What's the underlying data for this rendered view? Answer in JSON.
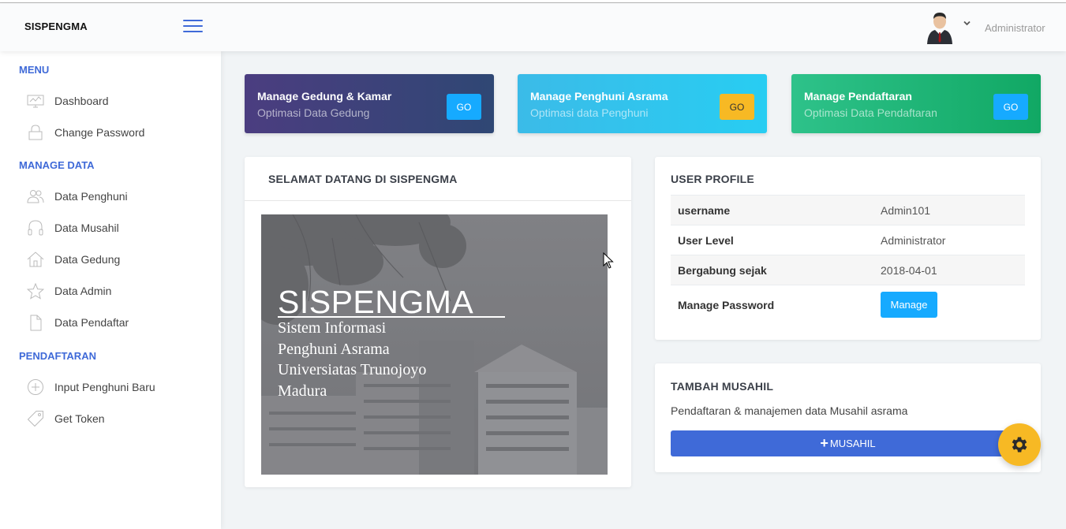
{
  "header": {
    "brand": "SISPENGMA",
    "user_name": "Administrator"
  },
  "sidebar": {
    "sections": [
      {
        "title": "MENU",
        "items": [
          {
            "label": "Dashboard",
            "icon": "monitor-icon"
          },
          {
            "label": "Change Password",
            "icon": "lock-icon"
          }
        ]
      },
      {
        "title": "MANAGE DATA",
        "items": [
          {
            "label": "Data Penghuni",
            "icon": "users-icon"
          },
          {
            "label": "Data Musahil",
            "icon": "headphones-icon"
          },
          {
            "label": "Data Gedung",
            "icon": "home-icon"
          },
          {
            "label": "Data Admin",
            "icon": "star-icon"
          },
          {
            "label": "Data Pendaftar",
            "icon": "file-icon"
          }
        ]
      },
      {
        "title": "PENDAFTARAN",
        "items": [
          {
            "label": "Input Penghuni Baru",
            "icon": "plus-circle-icon"
          },
          {
            "label": "Get Token",
            "icon": "tag-icon"
          }
        ]
      }
    ]
  },
  "tiles": [
    {
      "title": "Manage Gedung & Kamar",
      "subtitle": "Optimasi Data Gedung",
      "button": "GO",
      "button_color": "#16aaff"
    },
    {
      "title": "Manage Penghuni Asrama",
      "subtitle": "Optimasi data Penghuni",
      "button": "GO",
      "button_color": "#f7b924"
    },
    {
      "title": "Manage Pendaftaran",
      "subtitle": "Optimasi Data Pendaftaran",
      "button": "GO",
      "button_color": "#16aaff"
    }
  ],
  "welcome": {
    "title": "SELAMAT DATANG DI SISPENGMA",
    "hero_title": "SISPENGMA",
    "hero_lines": [
      "Sistem Informasi",
      "Penghuni Asrama",
      "Universiatas Trunojoyo",
      "Madura"
    ]
  },
  "profile": {
    "title": "USER PROFILE",
    "rows": [
      {
        "key": "username",
        "value": "Admin101"
      },
      {
        "key": "User Level",
        "value": "Administrator"
      },
      {
        "key": "Bergabung sejak",
        "value": "2018-04-01"
      }
    ],
    "password_label": "Manage Password",
    "manage_button": "Manage"
  },
  "musahil": {
    "title": "TAMBAH MUSAHIL",
    "description": "Pendaftaran & manajemen data Musahil asrama",
    "button_plus": "+",
    "button_label": "MUSAHIL"
  },
  "colors": {
    "accent": "#3f6ad8",
    "info": "#16aaff",
    "warning": "#f7b924",
    "success": "#11a864"
  }
}
